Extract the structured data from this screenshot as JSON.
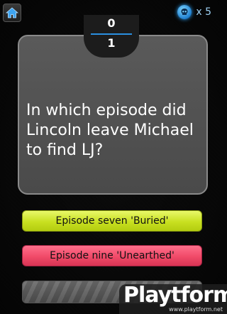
{
  "header": {
    "home_icon": "home-icon",
    "lives_icon": "skull-icon",
    "lives_count": "x 5"
  },
  "score": {
    "correct": "0",
    "total": "1"
  },
  "question": {
    "text": "In which episode did Lincoln leave Michael to find LJ?"
  },
  "answers": [
    {
      "label": "Episode seven 'Buried'",
      "color": "#c8e020"
    },
    {
      "label": "Episode nine 'Unearthed'",
      "color": "#f04a68"
    },
    {
      "label": "",
      "color": "#5a5a5a"
    }
  ],
  "watermark": {
    "logo": "Playtform",
    "url": "www.playtform.net"
  }
}
